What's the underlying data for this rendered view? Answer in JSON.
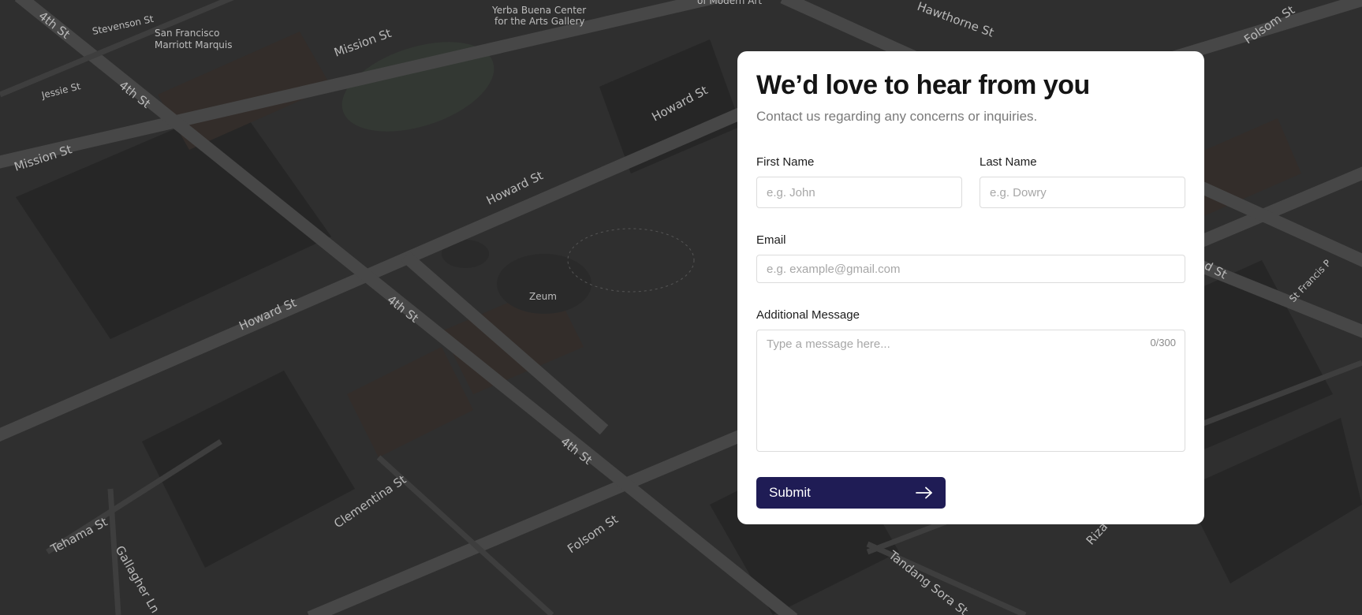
{
  "map": {
    "streets": [
      "4th St",
      "Stevenson St",
      "Mission St",
      "Jessie St",
      "Howard St",
      "Hawthorne St",
      "Folsom St",
      "Clementina St",
      "Tehama St",
      "Gallagher Ln",
      "Tandang Sora St",
      "St Francis P",
      "Riza",
      "d St"
    ],
    "places": [
      "San Francisco Marriott Marquis",
      "Yerba Buena Center for the Arts Gallery",
      "Zeum",
      "of Modern Art"
    ]
  },
  "form": {
    "title": "We’d love to hear from you",
    "subtitle": "Contact us regarding any concerns or inquiries.",
    "first_name": {
      "label": "First Name",
      "placeholder": "e.g. John",
      "value": ""
    },
    "last_name": {
      "label": "Last Name",
      "placeholder": "e.g. Dowry",
      "value": ""
    },
    "email": {
      "label": "Email",
      "placeholder": "e.g. example@gmail.com",
      "value": ""
    },
    "message": {
      "label": "Additional Message",
      "placeholder": "Type a message here...",
      "counter": "0/300",
      "value": ""
    },
    "submit_label": "Submit",
    "submit_icon": "arrow-right-icon",
    "accent_color": "#1f1c55"
  }
}
